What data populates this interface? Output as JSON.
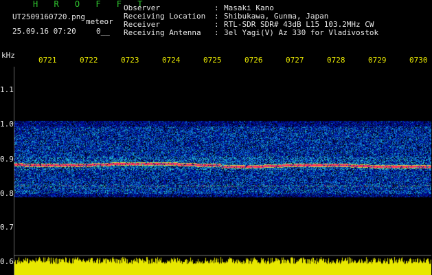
{
  "header": {
    "station": "H R O F F T",
    "filename": "UT2509160720.png",
    "meteor_tag": "meteor",
    "datetime": "25.09.16 07:20",
    "count": "0__"
  },
  "metadata": [
    {
      "label": "Observer",
      "value": "Masaki Kano"
    },
    {
      "label": "Receiving Location",
      "value": "Shibukawa, Gunma, Japan"
    },
    {
      "label": "Receiver",
      "value": "RTL-SDR SDR# 43dB L15 103.2MHz CW"
    },
    {
      "label": "Receiving Antenna",
      "value": "3el Yagi(V) Az 330 for Vladivostok"
    }
  ],
  "axis": {
    "unit": "kHz",
    "ticks": [
      "1.1",
      "1.0",
      "0.9",
      "0.8",
      "0.7",
      "0.6"
    ],
    "time_labels": [
      "0721",
      "0722",
      "0723",
      "0724",
      "0725",
      "0726",
      "0727",
      "0728",
      "0729",
      "0730"
    ]
  },
  "colors": {
    "background": "#000000",
    "labels": "#e8e8e8",
    "time_labels": "#e8e800",
    "station": "#30c830",
    "signal_band": "#ff3060"
  }
}
